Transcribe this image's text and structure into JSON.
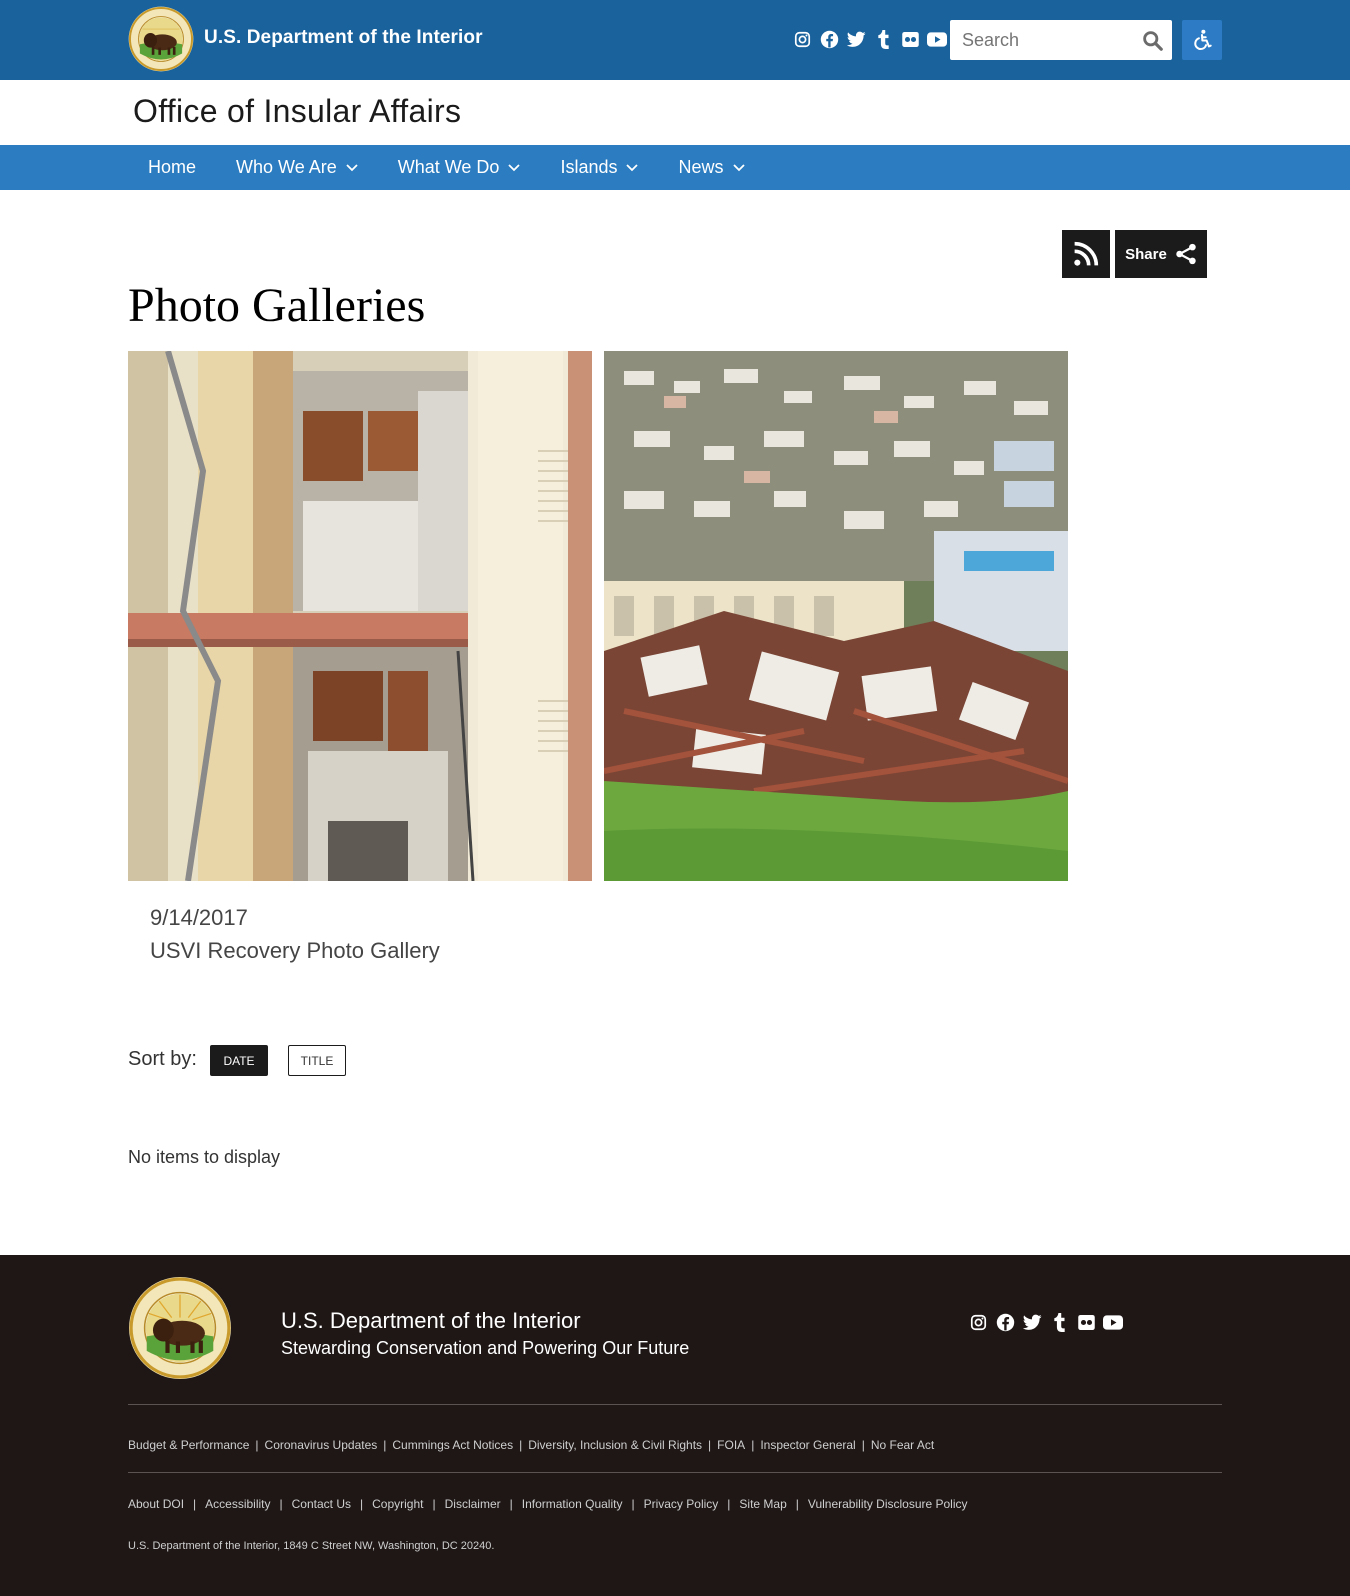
{
  "header": {
    "agency_title": "U.S. Department of the Interior",
    "seal_text": "U.S. DEPARTMENT OF THE INTERIOR · MARCH 3, 1849",
    "social_icons": [
      "instagram-icon",
      "facebook-icon",
      "twitter-icon",
      "tumblr-icon",
      "flickr-icon",
      "youtube-icon"
    ],
    "search": {
      "placeholder": "Search",
      "value": ""
    },
    "accessibility_icon": "accessibility-icon",
    "colors": {
      "bar": "#1a629c",
      "accessibility_button": "#2c7bc4"
    }
  },
  "office": {
    "title": "Office of Insular Affairs"
  },
  "nav": {
    "color": "#2b7cc0",
    "items": [
      {
        "label": "Home",
        "has_menu": false
      },
      {
        "label": "Who We Are",
        "has_menu": true
      },
      {
        "label": "What We Do",
        "has_menu": true
      },
      {
        "label": "Islands",
        "has_menu": true
      },
      {
        "label": "News",
        "has_menu": true
      }
    ]
  },
  "actions": {
    "rss_icon": "rss-icon",
    "share_label": "Share",
    "share_icon": "share-icon"
  },
  "page": {
    "title": "Photo Galleries"
  },
  "gallery": {
    "date": "9/14/2017",
    "title": "USVI Recovery Photo Gallery"
  },
  "sort": {
    "label": "Sort by:",
    "options": [
      "DATE",
      "TITLE"
    ],
    "active": "DATE"
  },
  "results": {
    "empty_message": "No items to display"
  },
  "footer": {
    "agency": "U.S. Department of the Interior",
    "tagline": "Stewarding Conservation and Powering Our Future",
    "links_row1": [
      "Budget & Performance",
      "Coronavirus Updates",
      "Cummings Act Notices",
      "Diversity, Inclusion & Civil Rights",
      "FOIA",
      "Inspector General",
      "No Fear Act"
    ],
    "links_row2": [
      "About DOI",
      "Accessibility",
      "Contact Us",
      "Copyright",
      "Disclaimer",
      "Information Quality",
      "Privacy Policy",
      "Site Map",
      "Vulnerability Disclosure Policy"
    ],
    "address": "U.S. Department of the Interior, 1849 C Street NW, Washington, DC 20240.",
    "background": "#1e1716"
  }
}
